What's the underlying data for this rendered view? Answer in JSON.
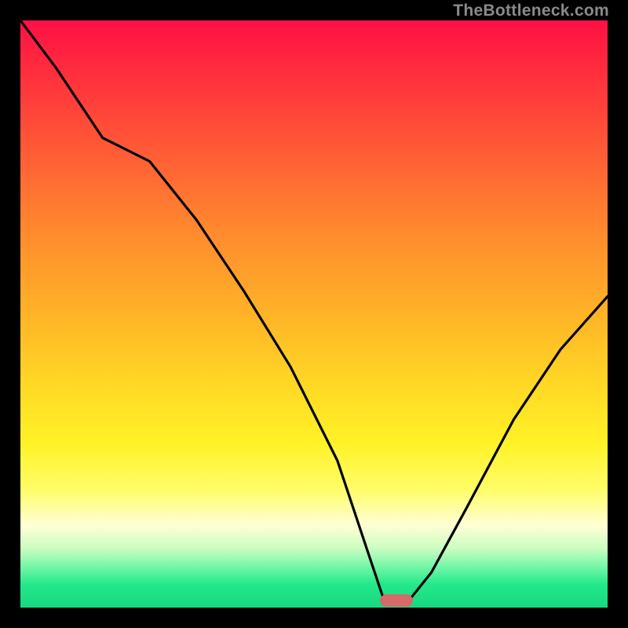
{
  "watermark": "TheBottleneck.com",
  "marker": {
    "x_frac": 0.64,
    "y_frac": 0.988
  },
  "colors": {
    "top": "#ff1044",
    "mid": "#ffd825",
    "bottom": "#17d880",
    "marker": "#d46a6a",
    "curve": "#000000"
  },
  "chart_data": {
    "type": "line",
    "title": "",
    "xlabel": "",
    "ylabel": "",
    "xlim": [
      0,
      1
    ],
    "ylim": [
      0,
      1
    ],
    "note": "Axes are unlabeled in the source image; values are normalized fractions of the plot area. The curve is a V-shaped bottleneck profile: high on the left, dipping to ~0 near x≈0.64, rising again on the right.",
    "series": [
      {
        "name": "bottleneck-curve",
        "x": [
          0.0,
          0.06,
          0.14,
          0.22,
          0.3,
          0.38,
          0.46,
          0.54,
          0.59,
          0.62,
          0.66,
          0.7,
          0.76,
          0.84,
          0.92,
          1.0
        ],
        "y": [
          1.0,
          0.92,
          0.8,
          0.76,
          0.66,
          0.54,
          0.41,
          0.25,
          0.1,
          0.01,
          0.01,
          0.06,
          0.17,
          0.32,
          0.44,
          0.53
        ]
      }
    ]
  }
}
